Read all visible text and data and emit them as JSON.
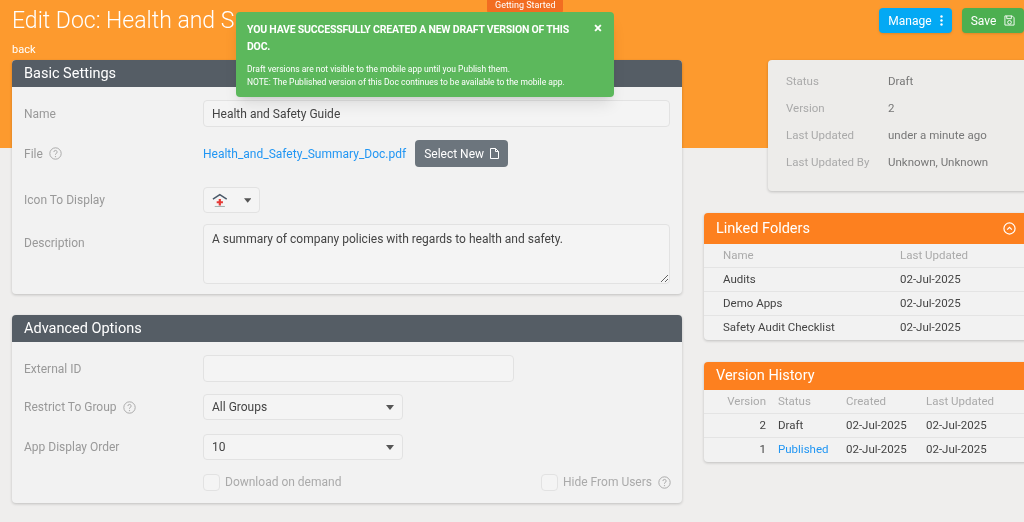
{
  "header": {
    "title": "Edit Doc: Health and S",
    "back_link": "back",
    "getting_started": "Getting Started",
    "buttons": [
      {
        "label": "Manage",
        "kind": "manage"
      },
      {
        "label": "Save",
        "kind": "save"
      }
    ]
  },
  "toast": {
    "title": "YOU HAVE SUCCESSFULLY CREATED A NEW DRAFT VERSION OF THIS DOC.",
    "close": "×",
    "lines": [
      "Draft versions are not visible to the mobile app until you Publish them.",
      "NOTE: The Published version of this Doc continues to be available to the mobile app."
    ]
  },
  "basic_settings": {
    "title": "Basic Settings",
    "name": {
      "label": "Name",
      "value": "Health and Safety Guide"
    },
    "file": {
      "label": "File",
      "link": "Health_and_Safety_Summary_Doc.pdf",
      "button": "Select New"
    },
    "icon": {
      "label": "Icon To Display"
    },
    "description": {
      "label": "Description",
      "value": "A summary of company policies with regards to health and safety."
    }
  },
  "advanced_options": {
    "title": "Advanced Options",
    "external_id": {
      "label": "External ID"
    },
    "restrict_to_group": {
      "label": "Restrict To Group",
      "value": "All Groups"
    },
    "app_display_order": {
      "label": "App Display Order",
      "value": "10"
    },
    "checkboxes": [
      {
        "label": "Download on demand",
        "checked": false,
        "help": false
      },
      {
        "label": "Hide From Users",
        "checked": false,
        "help": true
      }
    ]
  },
  "status_card": {
    "rows": [
      {
        "label": "Status",
        "value": "Draft"
      },
      {
        "label": "Version",
        "value": "2"
      },
      {
        "label": "Last Updated",
        "value": "under a minute ago"
      },
      {
        "label": "Last Updated By",
        "value": "Unknown, Unknown"
      }
    ]
  },
  "linked_folders": {
    "title": "Linked Folders",
    "expanded": true,
    "columns": [
      "Name",
      "Last Updated"
    ],
    "rows": [
      [
        "Audits",
        "02-Jul-2025"
      ],
      [
        "Demo Apps",
        "02-Jul-2025"
      ],
      [
        "Safety Audit Checklist",
        "02-Jul-2025"
      ]
    ]
  },
  "version_history": {
    "title": "Version History",
    "columns": [
      "Version",
      "Status",
      "Created",
      "Last Updated"
    ],
    "rows": [
      {
        "version": "2",
        "status": "Draft",
        "kind": "draft",
        "created": "02-Jul-2025",
        "last_updated": "02-Jul-2025"
      },
      {
        "version": "1",
        "status": "Published",
        "kind": "published",
        "created": "02-Jul-2025",
        "last_updated": "02-Jul-2025"
      }
    ]
  }
}
